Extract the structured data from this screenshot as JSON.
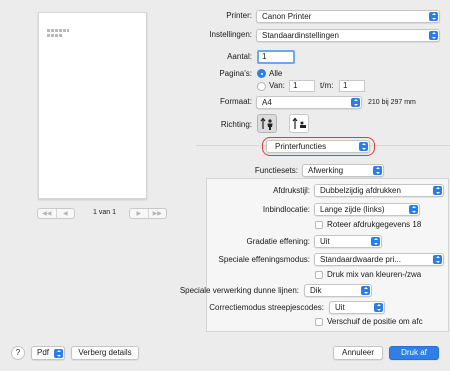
{
  "preview": {
    "page_label": "1 van 1"
  },
  "form": {
    "printer": {
      "label": "Printer:",
      "value": "Canon Printer"
    },
    "settings": {
      "label": "Instellingen:",
      "value": "Standaardinstellingen"
    },
    "copies": {
      "label": "Aantal:",
      "value": "1"
    },
    "pages": {
      "label": "Pagina's:",
      "all_label": "Alle",
      "from_label": "Van:",
      "from_value": "1",
      "to_label": "t/m:",
      "to_value": "1"
    },
    "paper": {
      "label": "Formaat:",
      "value": "A4",
      "size_text": "210 bij 297 mm"
    },
    "orientation": {
      "label": "Richting:"
    },
    "section": {
      "value": "Printerfuncties"
    },
    "feature_sets": {
      "label": "Functiesets:",
      "value": "Afwerking"
    }
  },
  "options": {
    "print_style": {
      "label": "Afdrukstijl:",
      "value": "Dubbelzijdig afdrukken"
    },
    "binding": {
      "label": "Inbindlocatie:",
      "value": "Lange zijde (links)"
    },
    "rotate": {
      "label": "Roteer afdrukgegevens 18"
    },
    "gradation": {
      "label": "Gradatie effening:",
      "value": "Uit"
    },
    "smoothing": {
      "label": "Speciale effeningsmodus:",
      "value": "Standaardwaarde pri..."
    },
    "color_mix": {
      "label": "Druk mix van kleuren-/zwa"
    },
    "thin_lines": {
      "label": "Speciale verwerking dunne lijnen:",
      "value": "Dik"
    },
    "barcode": {
      "label": "Correctiemodus streepjescodes:",
      "value": "Uit"
    },
    "shift": {
      "label": "Verschuif de positie om afc"
    }
  },
  "footer": {
    "help": "?",
    "pdf": "Pdf",
    "details": "Verberg details",
    "cancel": "Annuleer",
    "print": "Druk af"
  },
  "colors": {
    "accent": "#2f7fe6",
    "highlight_ring": "#e0393e"
  }
}
